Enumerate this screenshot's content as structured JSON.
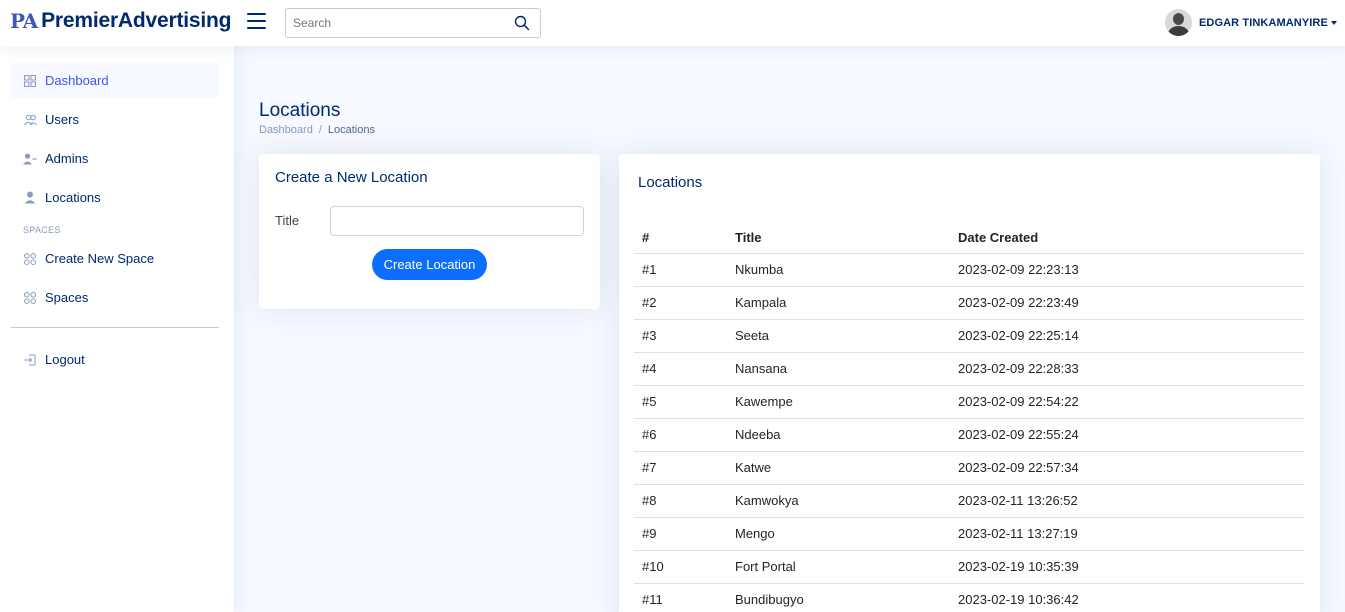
{
  "header": {
    "logo_mark": "PA",
    "logo_text": "PremierAdvertising",
    "search_placeholder": "Search",
    "user_name": "EDGAR TINKAMANYIRE"
  },
  "sidebar": {
    "items": [
      {
        "label": "Dashboard",
        "icon": "grid-icon",
        "active": true
      },
      {
        "label": "Users",
        "icon": "people-icon"
      },
      {
        "label": "Admins",
        "icon": "person-dash-icon"
      },
      {
        "label": "Locations",
        "icon": "person-icon"
      }
    ],
    "section_heading": "SPACES",
    "space_items": [
      {
        "label": "Create New Space",
        "icon": "grid-icon"
      },
      {
        "label": "Spaces",
        "icon": "grid-icon"
      }
    ],
    "logout_label": "Logout"
  },
  "page": {
    "title": "Locations",
    "breadcrumb": [
      "Dashboard",
      "Locations"
    ]
  },
  "create_form": {
    "title": "Create a New Location",
    "field_label": "Title",
    "field_value": "",
    "button_label": "Create Location"
  },
  "locations_table": {
    "title": "Locations",
    "headers": [
      "#",
      "Title",
      "Date Created"
    ],
    "rows": [
      [
        "#1",
        "Nkumba",
        "2023-02-09 22:23:13"
      ],
      [
        "#2",
        "Kampala",
        "2023-02-09 22:23:49"
      ],
      [
        "#3",
        "Seeta",
        "2023-02-09 22:25:14"
      ],
      [
        "#4",
        "Nansana",
        "2023-02-09 22:28:33"
      ],
      [
        "#5",
        "Kawempe",
        "2023-02-09 22:54:22"
      ],
      [
        "#6",
        "Ndeeba",
        "2023-02-09 22:55:24"
      ],
      [
        "#7",
        "Katwe",
        "2023-02-09 22:57:34"
      ],
      [
        "#8",
        "Kamwokya",
        "2023-02-11 13:26:52"
      ],
      [
        "#9",
        "Mengo",
        "2023-02-11 13:27:19"
      ],
      [
        "#10",
        "Fort Portal",
        "2023-02-19 10:35:39"
      ],
      [
        "#11",
        "Bundibugyo",
        "2023-02-19 10:36:42"
      ]
    ]
  },
  "colors": {
    "brand": "#012970",
    "accent": "#4154f1",
    "button": "#0d6efd",
    "background": "#f6f9ff"
  }
}
